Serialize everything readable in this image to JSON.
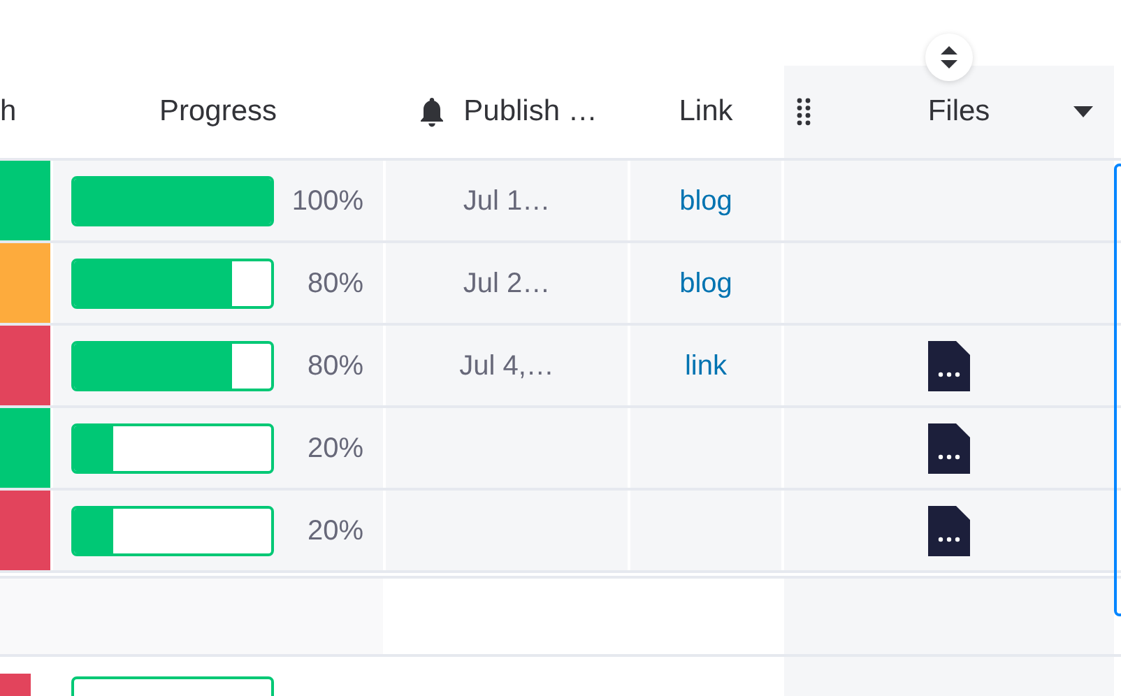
{
  "columns": [
    {
      "label": "h"
    },
    {
      "label": "Progress"
    },
    {
      "label": "Publish …"
    },
    {
      "label": "Link"
    },
    {
      "label": "Files",
      "selected": true
    }
  ],
  "rows": [
    {
      "color": "#00c875",
      "level": 1,
      "percent": "100%",
      "publish": "Jul 1…",
      "link": "blog",
      "has_file": false
    },
    {
      "color": "#fdab3d",
      "level": 0.8,
      "percent": "80%",
      "publish": "Jul 2…",
      "link": "blog",
      "has_file": false
    },
    {
      "color": "#e2445c",
      "level": 0.8,
      "percent": "80%",
      "publish": "Jul 4,…",
      "link": "link",
      "has_file": true
    },
    {
      "color": "#00c875",
      "level": 0.2,
      "percent": "20%",
      "publish": "",
      "link": "",
      "has_file": true
    },
    {
      "color": "#e2445c",
      "level": 0.2,
      "percent": "20%",
      "publish": "",
      "link": "",
      "has_file": true
    }
  ],
  "next_group": {
    "color": "#e2445c"
  }
}
